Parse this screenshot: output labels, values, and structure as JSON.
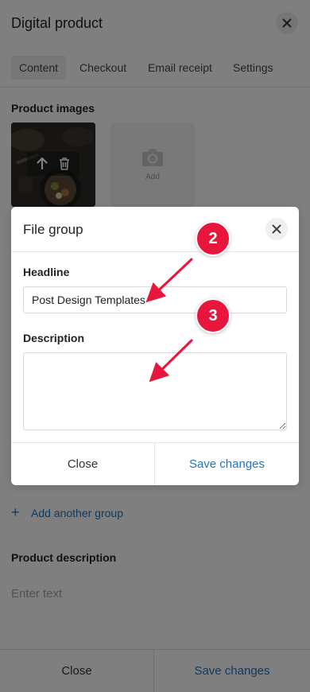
{
  "panel": {
    "title": "Digital product",
    "tabs": [
      {
        "label": "Content",
        "active": true
      },
      {
        "label": "Checkout",
        "active": false
      },
      {
        "label": "Email receipt",
        "active": false
      },
      {
        "label": "Settings",
        "active": false
      }
    ],
    "product_images_label": "Product images",
    "add_tile_label": "Add",
    "add_group_plus": "+",
    "add_group_label": "Add another group",
    "product_description_label": "Product description",
    "description_placeholder": "Enter text",
    "footer": {
      "close_label": "Close",
      "save_label": "Save changes"
    }
  },
  "modal": {
    "title": "File group",
    "headline_label": "Headline",
    "headline_value": "Post Design Templates",
    "description_label": "Description",
    "description_value": "",
    "close_label": "Close",
    "save_label": "Save changes"
  },
  "annotations": [
    {
      "number": "2"
    },
    {
      "number": "3"
    }
  ],
  "colors": {
    "accent": "#1f74c2",
    "annotation_red": "#e8163c",
    "overlay": "rgba(0,0,0,0.5)"
  }
}
